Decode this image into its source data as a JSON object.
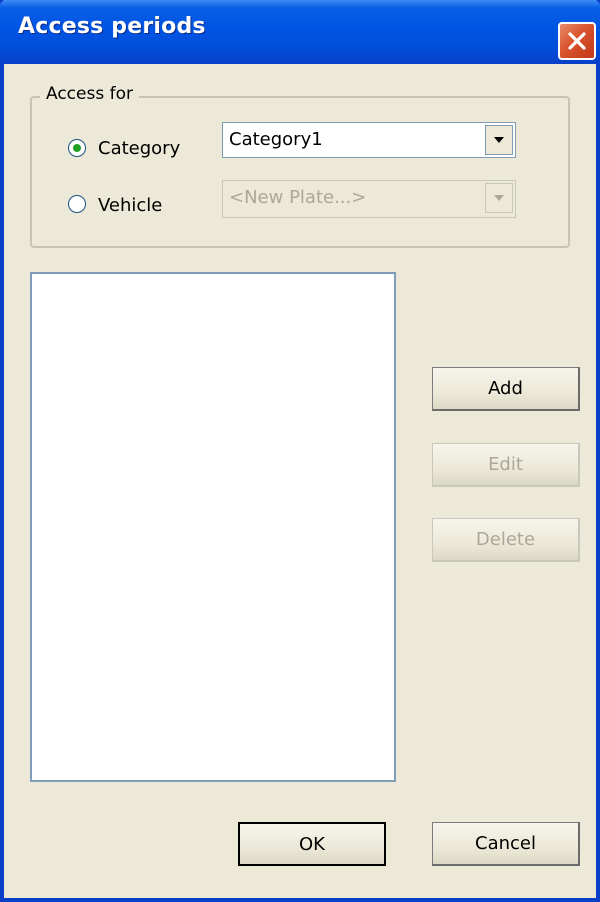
{
  "window": {
    "title": "Access periods"
  },
  "access_for": {
    "legend": "Access for",
    "options": [
      {
        "label": "Category",
        "selected": true
      },
      {
        "label": "Vehicle",
        "selected": false
      }
    ],
    "category_select": {
      "value": "Category1",
      "enabled": true
    },
    "vehicle_select": {
      "value": "<New Plate...>",
      "enabled": false
    }
  },
  "periods_list": {
    "items": []
  },
  "buttons": {
    "add": "Add",
    "edit": "Edit",
    "delete": "Delete",
    "ok": "OK",
    "cancel": "Cancel"
  },
  "colors": {
    "titlebar": "#0054e3",
    "close_button": "#d9532c",
    "dialog_background": "#ece9d8",
    "radio_selected_dot": "#21a121",
    "disabled_text": "#aca899"
  },
  "icons": {
    "close": "close-icon",
    "dropdown": "chevron-down-icon"
  }
}
